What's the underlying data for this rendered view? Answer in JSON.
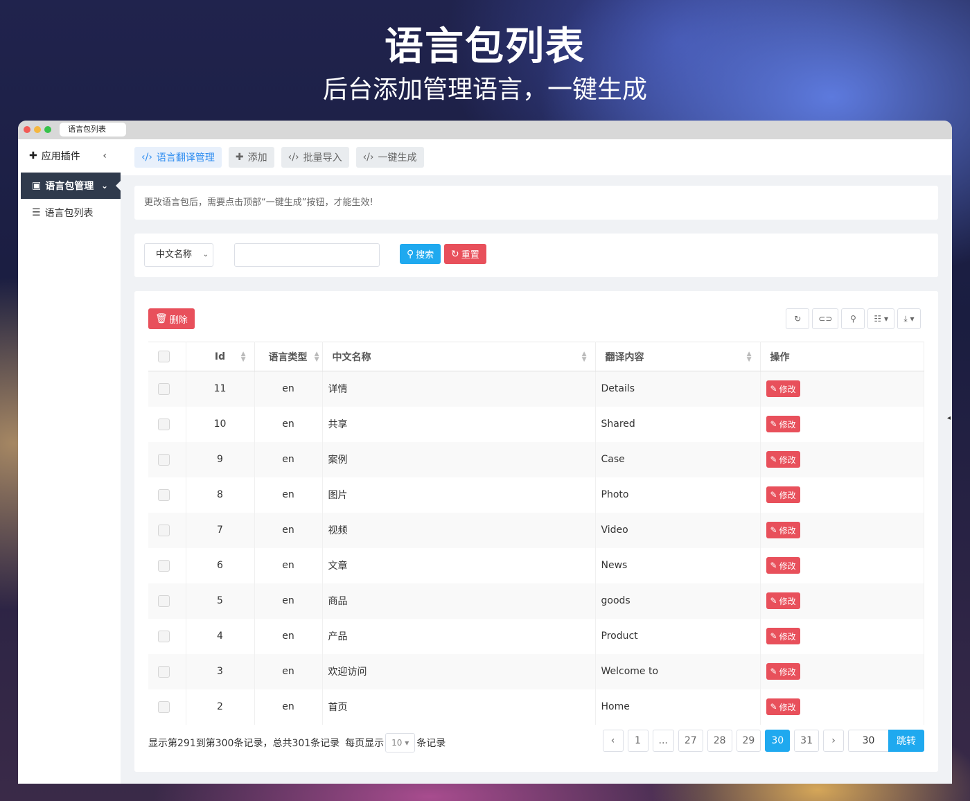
{
  "hero": {
    "title": "语言包列表",
    "subtitle": "后台添加管理语言，一键生成"
  },
  "window": {
    "tab_title": "语言包列表"
  },
  "sidebar": {
    "header": "应用插件",
    "active": "语言包管理",
    "sub_item": "语言包列表"
  },
  "topbar": {
    "tabs": [
      "语言翻译管理",
      "添加",
      "批量导入",
      "一键生成"
    ]
  },
  "notice": "更改语言包后，需要点击顶部“一键生成”按钮，才能生效!",
  "search": {
    "field_select": "中文名称",
    "keyword_value": "",
    "search_label": "搜索",
    "reset_label": "重置"
  },
  "table": {
    "delete_label": "删除",
    "columns": [
      "Id",
      "语言类型",
      "中文名称",
      "翻译内容",
      "操作"
    ],
    "edit_label": "修改",
    "rows": [
      {
        "id": "11",
        "lang": "en",
        "name": "详情",
        "trans": "Details"
      },
      {
        "id": "10",
        "lang": "en",
        "name": "共享",
        "trans": "Shared"
      },
      {
        "id": "9",
        "lang": "en",
        "name": "案例",
        "trans": "Case"
      },
      {
        "id": "8",
        "lang": "en",
        "name": "图片",
        "trans": "Photo"
      },
      {
        "id": "7",
        "lang": "en",
        "name": "视频",
        "trans": "Video"
      },
      {
        "id": "6",
        "lang": "en",
        "name": "文章",
        "trans": "News"
      },
      {
        "id": "5",
        "lang": "en",
        "name": "商品",
        "trans": "goods"
      },
      {
        "id": "4",
        "lang": "en",
        "name": "产品",
        "trans": "Product"
      },
      {
        "id": "3",
        "lang": "en",
        "name": "欢迎访问",
        "trans": "Welcome to"
      },
      {
        "id": "2",
        "lang": "en",
        "name": "首页",
        "trans": "Home"
      }
    ]
  },
  "pager": {
    "info_prefix": "显示第291到第300条记录，总共301条记录",
    "per_page_label": "每页显示",
    "per_page_value": "10",
    "per_page_suffix": "条记录",
    "prev": "‹",
    "next": "›",
    "pages": [
      "1",
      "...",
      "27",
      "28",
      "29",
      "30",
      "31"
    ],
    "current": "30",
    "jump_value": "30",
    "jump_label": "跳转"
  },
  "colors": {
    "primary": "#1fa9ef",
    "danger": "#e8505b",
    "sidebar_active": "#2f3a4c"
  }
}
